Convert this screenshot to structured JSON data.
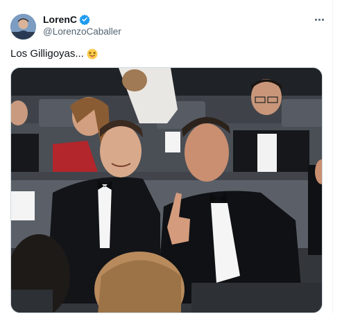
{
  "author": {
    "display_name": "LorenC",
    "handle": "@LorenzoCaballer",
    "verified": true,
    "verified_color": "#1d9bf0"
  },
  "tweet": {
    "text": "Los Gilligoyas...",
    "emoji": "squinting-face-with-tongue"
  },
  "icons": {
    "more": "more-horizontal-icon",
    "verified": "verified-badge-icon"
  },
  "media": {
    "kind": "photo",
    "subject": "two men in tuxedos seated in a theater audience"
  }
}
